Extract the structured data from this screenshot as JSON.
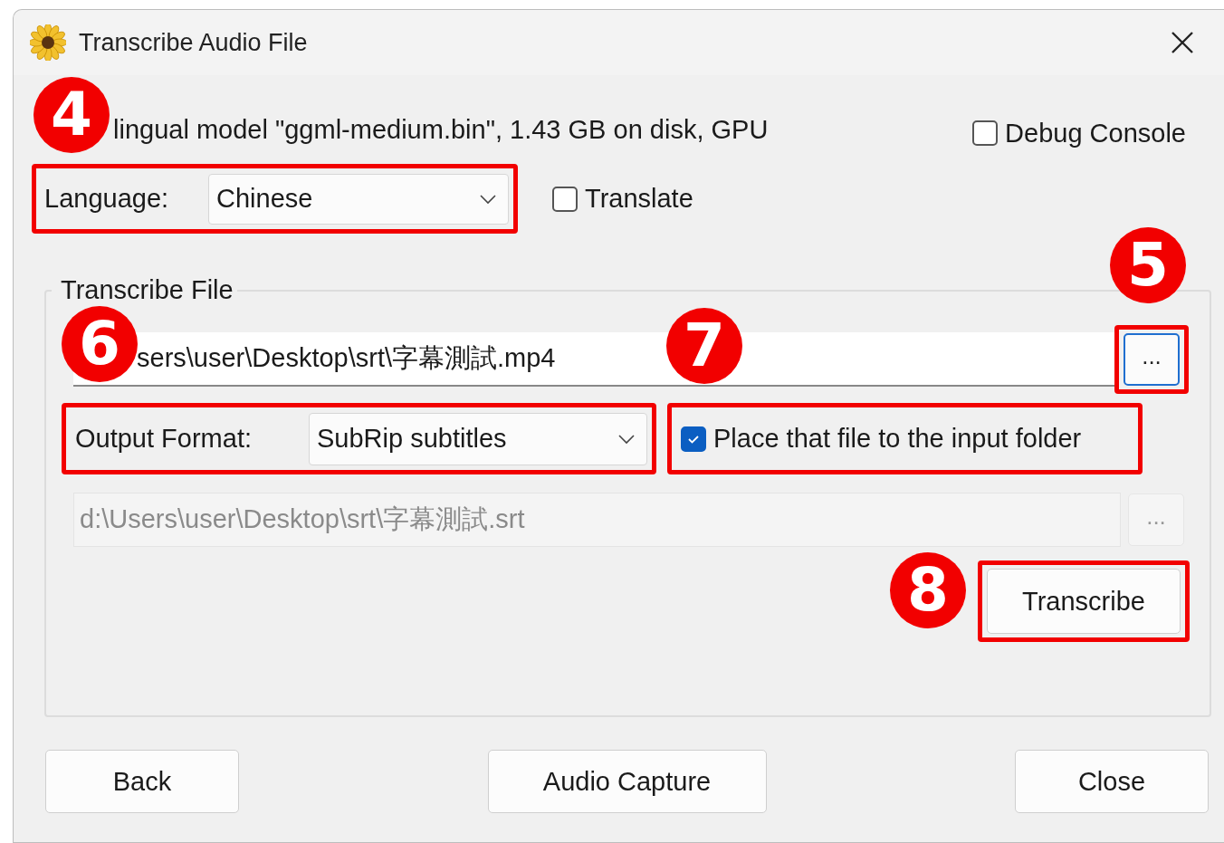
{
  "window": {
    "title": "Transcribe Audio File"
  },
  "model_info": "lingual model \"ggml-medium.bin\", 1.43 GB on disk, GPU",
  "debug_console": {
    "label": "Debug Console",
    "checked": false
  },
  "language": {
    "label": "Language:",
    "value": "Chinese",
    "highlighted": true
  },
  "translate": {
    "label": "Translate",
    "checked": false
  },
  "group": {
    "title": "Transcribe File",
    "input_file": {
      "value": "sers\\user\\Desktop\\srt\\字幕測試.mp4"
    },
    "input_browse": {
      "label": "...",
      "highlighted": true
    },
    "output_format": {
      "label": "Output Format:",
      "value": "SubRip subtitles",
      "highlighted": true
    },
    "place_in_input_folder": {
      "label": "Place that file to the input folder",
      "checked": true,
      "highlighted": true
    },
    "output_file": {
      "value": "d:\\Users\\user\\Desktop\\srt\\字幕測試.srt",
      "disabled": true
    },
    "output_browse": {
      "label": "...",
      "disabled": true
    },
    "transcribe": {
      "label": "Transcribe",
      "highlighted": true
    }
  },
  "buttons": [
    {
      "label": "Back"
    },
    {
      "label": "Audio Capture"
    },
    {
      "label": "Close"
    }
  ],
  "callouts": [
    {
      "label": "4"
    },
    {
      "label": "5"
    },
    {
      "label": "6"
    },
    {
      "label": "7"
    },
    {
      "label": "8"
    }
  ]
}
